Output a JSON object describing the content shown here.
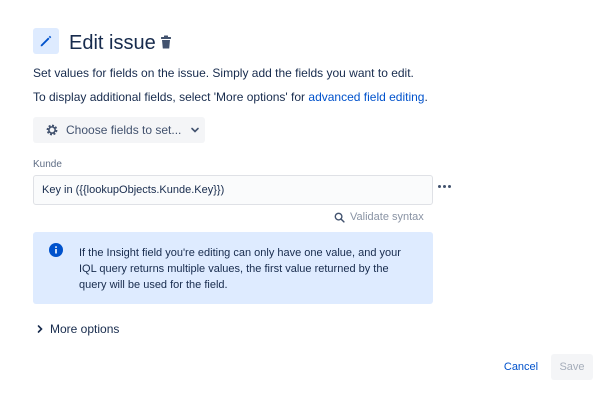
{
  "header": {
    "icon": "pencil-icon",
    "title": "Edit issue",
    "trash_icon": "trash-icon"
  },
  "description": {
    "line1": "Set values for fields on the issue. Simply add the fields you want to edit.",
    "line2_prefix": "To display additional fields, select 'More options' for ",
    "line2_link": "advanced field editing",
    "line2_suffix": "."
  },
  "choose_fields": {
    "icon": "gear-icon",
    "label": "Choose fields to set...",
    "chevron_icon": "chevron-down-icon"
  },
  "field": {
    "label": "Kunde",
    "value": "Key in ({{lookupObjects.Kunde.Key}})",
    "more_icon": "more-horizontal-icon"
  },
  "validate": {
    "icon": "search-icon",
    "label": "Validate syntax"
  },
  "info": {
    "icon": "info-icon",
    "text": "If the Insight field you're editing can only have one value, and your IQL query returns multiple values, the first value returned by the query will be used for the field."
  },
  "more_options": {
    "icon": "chevron-right-icon",
    "label": "More options"
  },
  "footer": {
    "cancel_label": "Cancel",
    "save_label": "Save"
  },
  "colors": {
    "link": "#0052cc",
    "info_bg": "#deebff",
    "icon_bg": "#deebff"
  }
}
